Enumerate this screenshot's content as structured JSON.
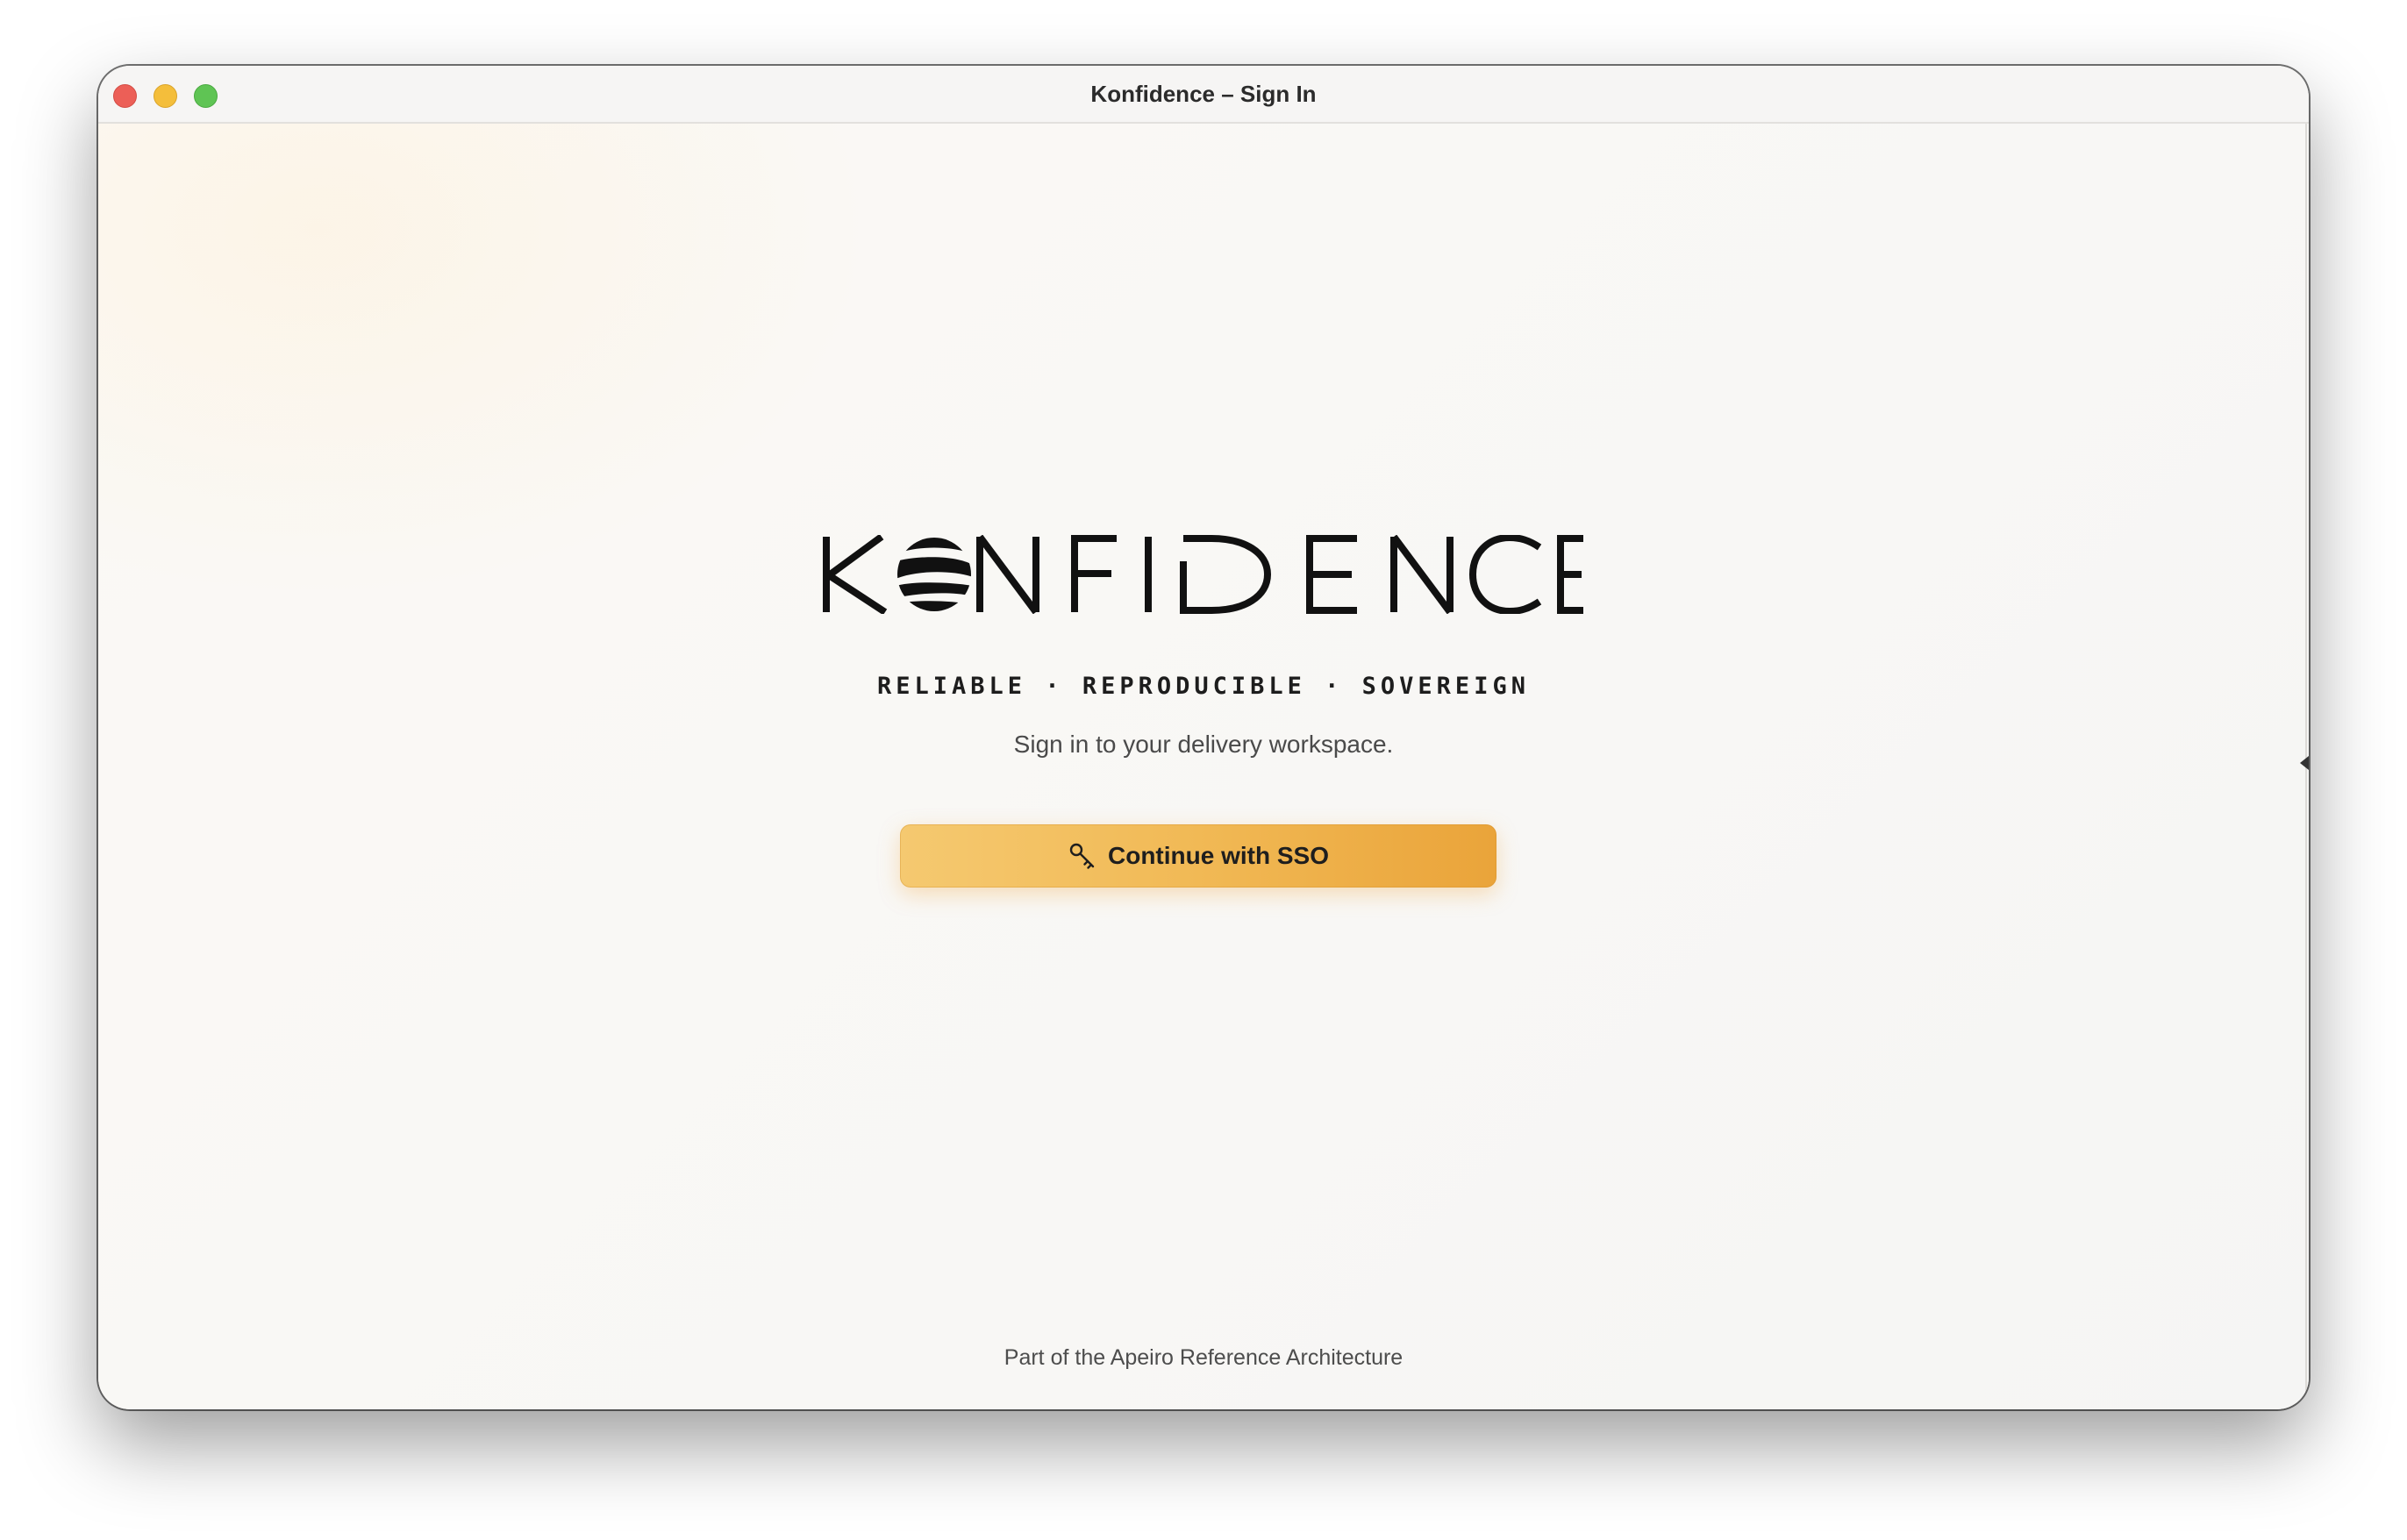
{
  "window": {
    "title": "Konfidence – Sign In"
  },
  "brand": {
    "logo_text": "KONFIDENCE",
    "tagline": "RELIABLE · REPRODUCIBLE · SOVEREIGN"
  },
  "signin": {
    "subtitle": "Sign in to your delivery workspace.",
    "sso_button_label": "Continue with SSO",
    "sso_button_icon": "key-icon"
  },
  "footer": {
    "text": "Part of the Apeiro Reference Architecture"
  },
  "colors": {
    "accent_start": "#f5c970",
    "accent_end": "#eaa43a",
    "text": "#1d1d1d"
  }
}
